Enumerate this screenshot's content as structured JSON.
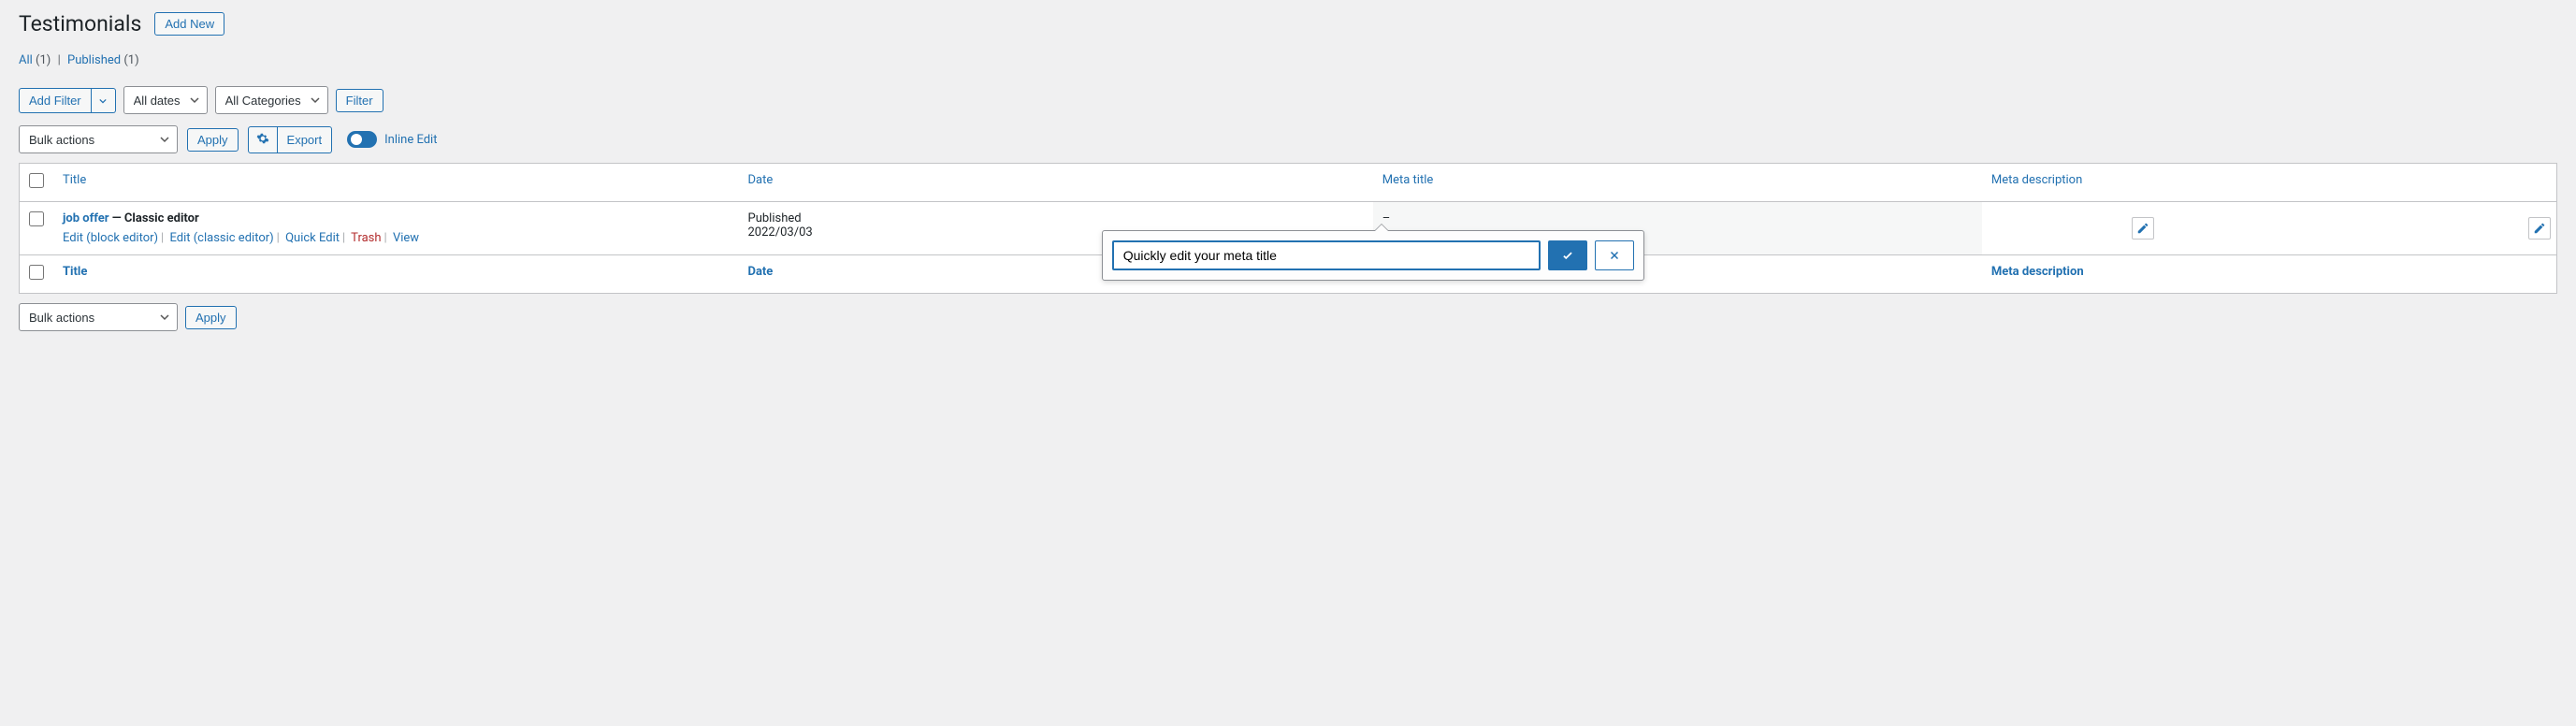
{
  "header": {
    "title": "Testimonials",
    "add_new_label": "Add New"
  },
  "status_links": {
    "all_label": "All",
    "all_count": "(1)",
    "published_label": "Published",
    "published_count": "(1)"
  },
  "filters": {
    "add_filter_label": "Add Filter",
    "dates_selected": "All dates",
    "categories_selected": "All Categories",
    "filter_btn_label": "Filter"
  },
  "bulk": {
    "actions_selected": "Bulk actions",
    "apply_label": "Apply",
    "export_label": "Export",
    "inline_edit_label": "Inline Edit"
  },
  "columns": {
    "title": "Title",
    "date": "Date",
    "meta_title": "Meta title",
    "meta_desc": "Meta description"
  },
  "rows": [
    {
      "title": "job offer",
      "state": " — Classic editor",
      "actions": {
        "edit_block": "Edit (block editor)",
        "edit_classic": "Edit (classic editor)",
        "quick_edit": "Quick Edit",
        "trash": "Trash",
        "view": "View"
      },
      "date_status": "Published",
      "date_value": "2022/03/03",
      "meta_title_text": "–"
    }
  ],
  "inline_editor": {
    "value": "Quickly edit your meta title"
  }
}
